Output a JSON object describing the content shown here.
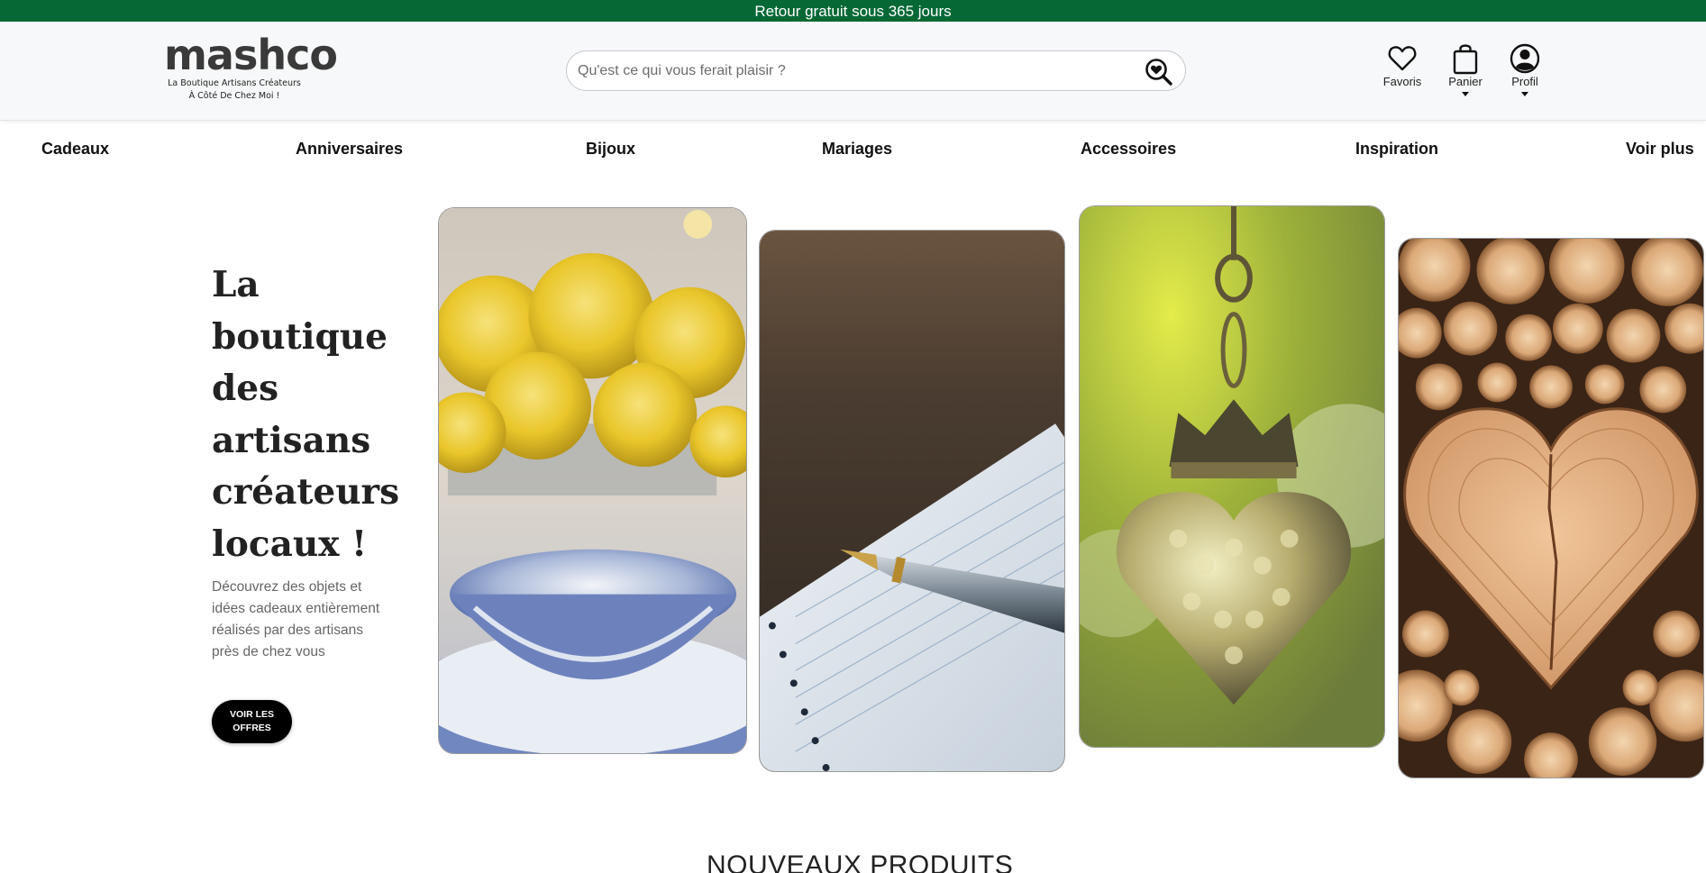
{
  "promo": {
    "text": "Retour gratuit sous 365 jours"
  },
  "header": {
    "logo": {
      "wordmark": "mashco",
      "tagline_line1": "La Boutique Artisans Créateurs",
      "tagline_line2": "À Côté De Chez Moi !"
    },
    "search": {
      "placeholder": "Qu'est ce qui vous ferait plaisir ?",
      "value": ""
    },
    "account": {
      "favorites": "Favoris",
      "cart": "Panier",
      "profile": "Profil"
    }
  },
  "nav": {
    "items": [
      "Cadeaux",
      "Anniversaires",
      "Bijoux",
      "Mariages",
      "Accessoires",
      "Inspiration",
      "Voir plus"
    ]
  },
  "hero": {
    "title": "La boutique des artisans créateurs locaux !",
    "subtitle": "Découvrez des objets et idées cadeaux entièrement réalisés par des artisans près de chez vous",
    "cta": "VOIR LES OFFRES"
  },
  "images": [
    {
      "icon": "roses-bowl-image"
    },
    {
      "icon": "notebook-pen-image"
    },
    {
      "icon": "crown-heart-pendant-image"
    },
    {
      "icon": "wood-logs-heart-image"
    }
  ],
  "section": {
    "title": "NOUVEAUX PRODUITS"
  },
  "colors": {
    "promo_bg": "#056835",
    "header_bg": "#f7f8f9",
    "cta_bg": "#000000"
  }
}
